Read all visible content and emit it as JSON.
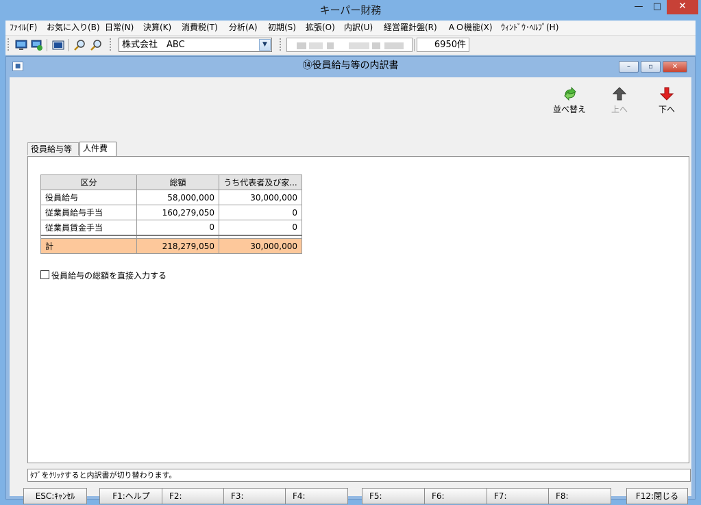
{
  "app": {
    "title": "キーパー財務",
    "min": "—",
    "max": "□",
    "close": "✕"
  },
  "menu": [
    "ﾌｧｲﾙ(F)",
    "お気に入り(B)",
    "日常(N)",
    "決算(K)",
    "消費税(T)",
    "分析(A)",
    "初期(S)",
    "拡張(O)",
    "内訳(U)",
    "経営羅針盤(R)",
    "ＡＯ機能(X)",
    "ｳｨﾝﾄﾞｳ･ﾍﾙﾌﾟ(H)"
  ],
  "toolbar": {
    "company": "株式会社　ABC",
    "count": "6950件"
  },
  "document": {
    "title": "⑭役員給与等の内訳書",
    "min": "–",
    "max": "▫",
    "close": "✕"
  },
  "actions": {
    "sort": "並べ替え",
    "up": "上へ",
    "down": "下へ"
  },
  "tabs": [
    "役員給与等",
    "人件費"
  ],
  "table": {
    "headers": [
      "区分",
      "総額",
      "うち代表者及び家..."
    ],
    "rows": [
      [
        "役員給与",
        "58,000,000",
        "30,000,000"
      ],
      [
        "従業員給与手当",
        "160,279,050",
        "0"
      ],
      [
        "従業員賃金手当",
        "0",
        "0"
      ]
    ],
    "total": [
      "計",
      "218,279,050",
      "30,000,000"
    ]
  },
  "checkbox_label": "役員給与の総額を直接入力する",
  "status_text": "ﾀﾌﾞをｸﾘｯｸすると内訳書が切り替わります。",
  "fkeys": {
    "esc": "ESC:ｷｬﾝｾﾙ",
    "f1": "F1:ヘルプ",
    "f2": "F2:",
    "f3": "F3:",
    "f4": "F4:",
    "f5": "F5:",
    "f6": "F6:",
    "f7": "F7:",
    "f8": "F8:",
    "f12": "F12:閉じる"
  },
  "colors": {
    "title_bar": "#7fb2e5",
    "total_row": "#fdc89b",
    "close_button": "#c74137"
  }
}
